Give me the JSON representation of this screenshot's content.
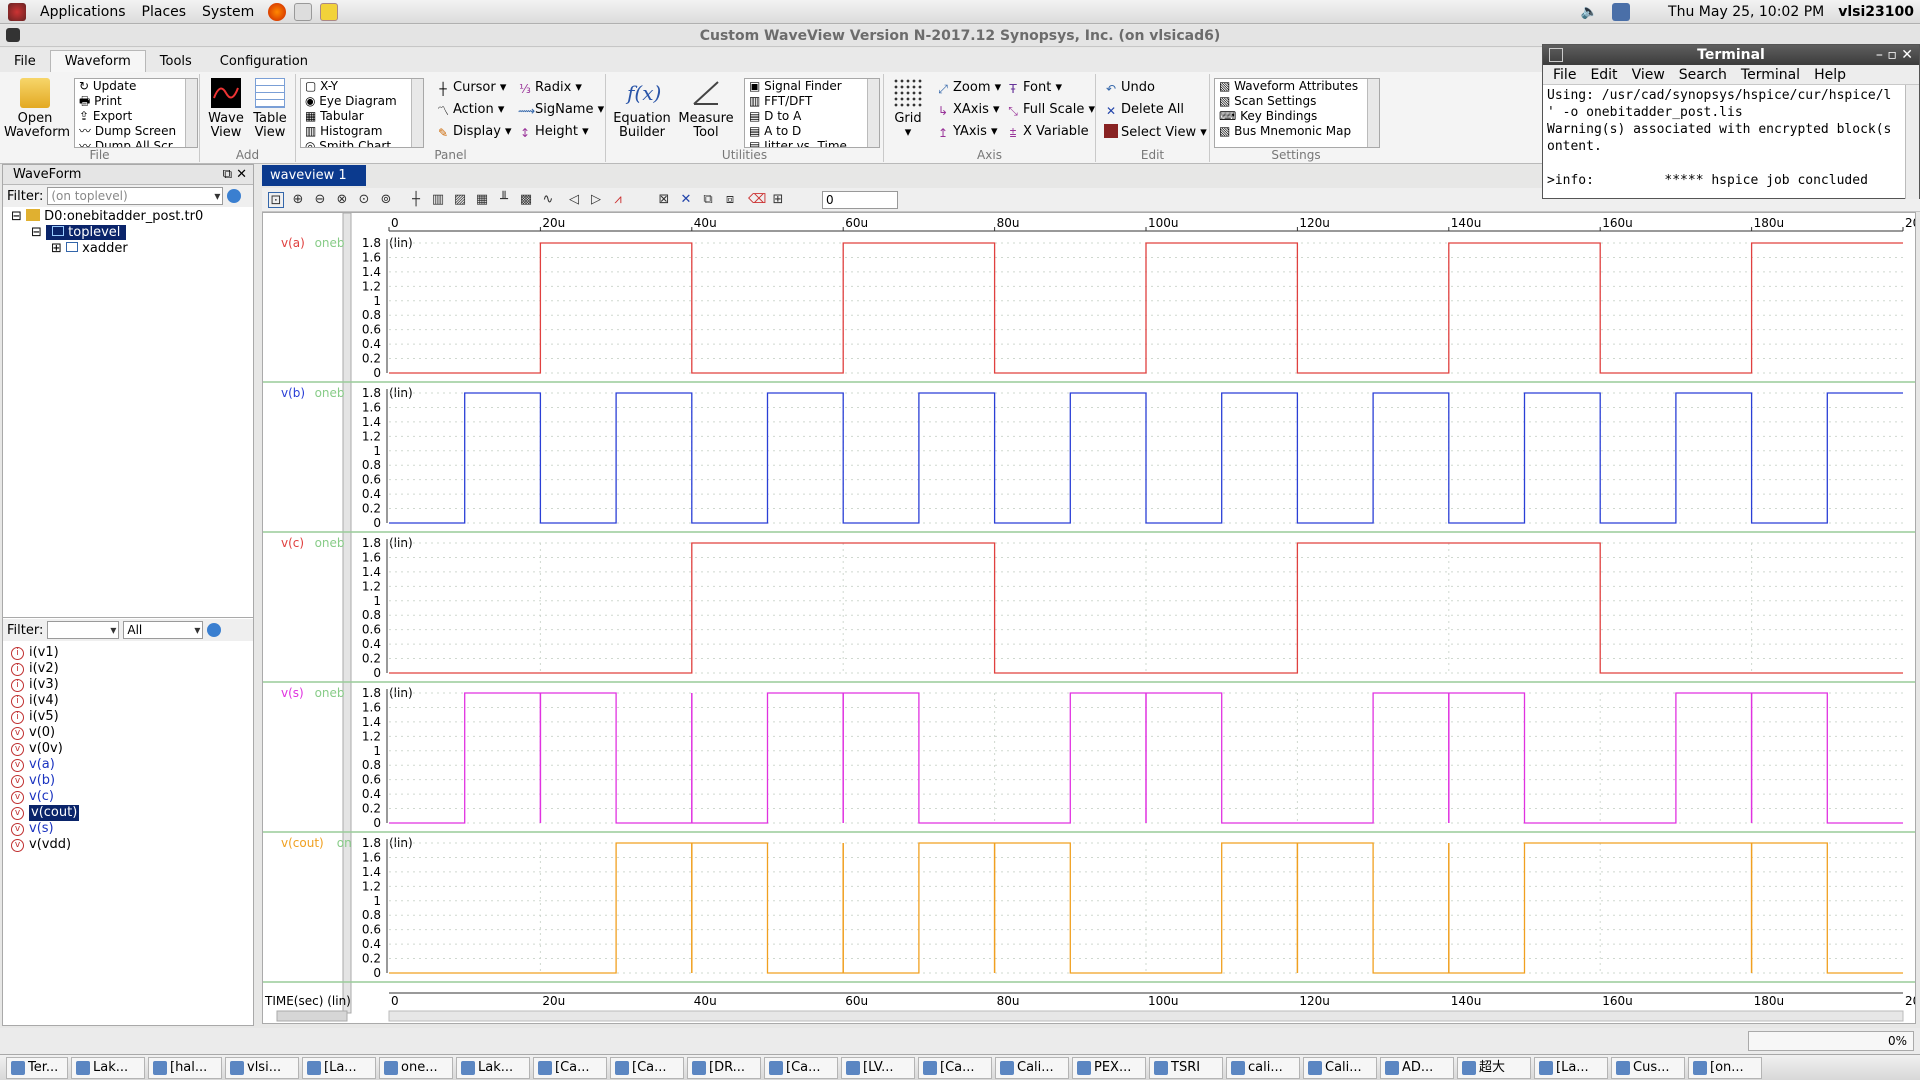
{
  "topbar": {
    "menus": [
      "Applications",
      "Places",
      "System"
    ],
    "datetime": "Thu May 25, 10:02 PM",
    "user": "vlsi23100"
  },
  "window": {
    "title": "Custom WaveView Version N-2017.12 Synopsys, Inc.     (on vlsicad6)"
  },
  "menubar": [
    "File",
    "Waveform",
    "Tools",
    "Configuration"
  ],
  "ribbon": {
    "file_group": {
      "label": "File",
      "open_btn": [
        "Open",
        "Waveform"
      ],
      "list": [
        "Update",
        "Print",
        "Export",
        "Dump Screen",
        "Dump All Scr..."
      ]
    },
    "add_group": {
      "label": "Add",
      "wave_view": [
        "Wave",
        "View"
      ],
      "table_view": [
        "Table",
        "View"
      ]
    },
    "panel_group": {
      "label": "Panel",
      "list": [
        "X-Y",
        "Eye Diagram",
        "Tabular",
        "Histogram",
        "Smith Chart"
      ],
      "col1": [
        "Cursor",
        "Action",
        "Display"
      ],
      "col2": [
        "Radix",
        "SigName",
        "Height"
      ]
    },
    "utilities_group": {
      "label": "Utilities",
      "equation": [
        "Equation",
        "Builder"
      ],
      "measure": [
        "Measure",
        "Tool"
      ],
      "list": [
        "Signal Finder",
        "FFT/DFT",
        "D to A",
        "A to D",
        "Jitter vs. Time"
      ]
    },
    "axis_group": {
      "label": "Axis",
      "grid": "Grid",
      "col1": [
        "Zoom",
        "XAxis",
        "YAxis"
      ],
      "col2": [
        "Font",
        "Full Scale",
        "X Variable"
      ]
    },
    "edit_group": {
      "label": "Edit",
      "items": [
        "Undo",
        "Delete All",
        "Select View"
      ]
    },
    "settings_group": {
      "label": "Settings",
      "list": [
        "Waveform Attributes",
        "Scan Settings",
        "Key Bindings",
        "Bus Mnemonic Map"
      ]
    }
  },
  "leftpane": {
    "title": "WaveForm",
    "filter_label": "Filter:",
    "filter_placeholder": "(on toplevel)",
    "tree": [
      "D0:onebitadder_post.tr0",
      "toplevel",
      "xadder"
    ],
    "filter2_label": "Filter:",
    "filter2_value": "All",
    "signals": [
      "i(v1)",
      "i(v2)",
      "i(v3)",
      "i(v4)",
      "i(v5)",
      "v(0)",
      "v(0v)",
      "v(a)",
      "v(b)",
      "v(c)",
      "v(cout)",
      "v(s)",
      "v(vdd)"
    ],
    "selected_signal": "v(cout)"
  },
  "wave": {
    "tab": "waveview 1",
    "xinput": "0",
    "xlabel": "TIME(sec) (lin)",
    "xticks": [
      "0",
      "20u",
      "40u",
      "60u",
      "80u",
      "100u",
      "120u",
      "140u",
      "160u",
      "180u",
      "200u"
    ],
    "yticks": [
      "1.8",
      "1.6",
      "1.4",
      "1.2",
      "1",
      "0.8",
      "0.6",
      "0.4",
      "0.2",
      "0"
    ],
    "scale_tag": "(lin)"
  },
  "chart_data": {
    "type": "line",
    "xlabel": "TIME(sec) (lin)",
    "xunit": "s",
    "xlim": [
      0,
      0.0002
    ],
    "ylim": [
      0,
      1.8
    ],
    "series": [
      {
        "name": "v(a)",
        "label": "v(a)",
        "suffix": "oneb",
        "color": "#e0403f",
        "transitions": [
          0,
          2e-05,
          4e-05,
          6e-05,
          8e-05,
          0.0001,
          0.00012,
          0.00014,
          0.00016,
          0.00018,
          0.0002
        ],
        "start_high": false
      },
      {
        "name": "v(b)",
        "label": "v(b)",
        "suffix": "oneb",
        "color": "#2a3fd6",
        "transitions": [
          0,
          1e-05,
          2e-05,
          3e-05,
          4e-05,
          5e-05,
          6e-05,
          7e-05,
          8e-05,
          9e-05,
          0.0001,
          0.00011,
          0.00012,
          0.00013,
          0.00014,
          0.00015,
          0.00016,
          0.00017,
          0.00018,
          0.00019,
          0.0002
        ],
        "start_high": false
      },
      {
        "name": "v(c)",
        "label": "v(c)",
        "suffix": "oneb",
        "color": "#e0403f",
        "transitions": [
          0,
          4e-05,
          8e-05,
          0.00012,
          0.00016,
          0.0002
        ],
        "start_high": false
      },
      {
        "name": "v(s)",
        "label": "v(s)",
        "suffix": "oneb",
        "color": "#e032e0",
        "transitions": [
          0,
          1e-05,
          3e-05,
          5e-05,
          7e-05,
          9e-05,
          0.00011,
          0.00013,
          0.00015,
          0.00017,
          0.00019,
          0.0002
        ],
        "start_high": false,
        "glitches": [
          2e-05,
          4e-05,
          6e-05,
          0.0001,
          0.00014,
          0.00018
        ]
      },
      {
        "name": "v(cout)",
        "label": "v(cout)",
        "suffix": "on",
        "color": "#f0a020",
        "transitions": [
          0,
          3e-05,
          5e-05,
          7e-05,
          9e-05,
          0.00011,
          0.00013,
          0.00015,
          0.00019,
          0.0002
        ],
        "start_high": false,
        "glitches": [
          4e-05,
          6e-05,
          8e-05,
          0.00012,
          0.00014,
          0.00018
        ]
      }
    ]
  },
  "terminal": {
    "title": "Terminal",
    "menus": [
      "File",
      "Edit",
      "View",
      "Search",
      "Terminal",
      "Help"
    ],
    "lines": [
      "Using: /usr/cad/synopsys/hspice/cur/hspice/l",
      "' -o onebitadder_post.lis",
      "Warning(s) associated with encrypted block(s",
      "ontent.",
      "",
      ">info:         ***** hspice job concluded"
    ]
  },
  "status": {
    "progress": "0%"
  },
  "taskbar": [
    "Ter...",
    "Lak...",
    "[hal...",
    "vlsi...",
    "[La...",
    "one...",
    "Lak...",
    "[Ca...",
    "[Ca...",
    "[DR...",
    "[Ca...",
    "[LV...",
    "[Ca...",
    "Cali...",
    "PEX...",
    "TSRI",
    "cali...",
    "Cali...",
    "AD...",
    "超大",
    "[La...",
    "Cus...",
    "[on..."
  ]
}
